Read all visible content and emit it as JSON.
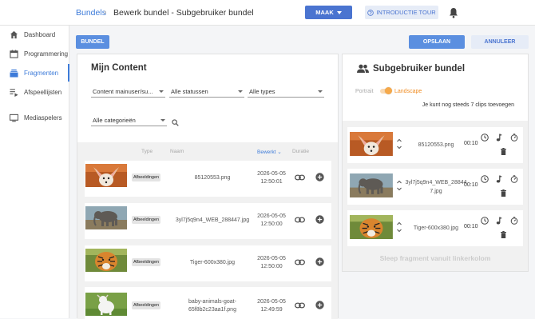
{
  "topbar": {
    "breadcrumb_root": "Bundels",
    "breadcrumb_sep": "›",
    "breadcrumb_current": "Bewerk bundel - Subgebruiker bundel",
    "maak_label": "MAAK",
    "tour_label": "INTRODUCTIE TOUR"
  },
  "sidebar": {
    "items": [
      {
        "label": "Dashboard",
        "icon": "home-icon"
      },
      {
        "label": "Programmering",
        "icon": "calendar-icon"
      },
      {
        "label": "Fragmenten",
        "icon": "fragments-icon",
        "active": true
      },
      {
        "label": "Afspeellijsten",
        "icon": "playlist-icon"
      },
      {
        "label": "Mediaspelers",
        "icon": "monitor-icon"
      }
    ]
  },
  "actions": {
    "bundel_label": "BUNDEL",
    "opslaan_label": "OPSLAAN",
    "annuleer_label": "ANNULEER"
  },
  "left_panel": {
    "title": "Mijn Content",
    "filters": {
      "content": "Content mainuser/su...",
      "status": "Alle statussen",
      "type": "Alle types",
      "category": "Alle categorieën"
    },
    "columns": {
      "type": "Type",
      "name": "Naam",
      "edited": "Bewerkt",
      "duration": "Duratie"
    },
    "rows": [
      {
        "badge": "Afbeeldingen",
        "name": "85120553.png",
        "date": "2026-05-05",
        "time": "12:50:01",
        "thumb": "fennec-fox"
      },
      {
        "badge": "Afbeeldingen",
        "name": "3yl7j5q9n4_WEB_288447.jpg",
        "date": "2026-05-05",
        "time": "12:50:00",
        "thumb": "elephant"
      },
      {
        "badge": "Afbeeldingen",
        "name": "Tiger-600x380.jpg",
        "date": "2026-05-05",
        "time": "12:50:00",
        "thumb": "tiger"
      },
      {
        "badge": "Afbeeldingen",
        "name": "baby-animals-goat-65f8b2c23aa1f.png",
        "date": "2026-05-05",
        "time": "12:49:59",
        "thumb": "goat"
      }
    ]
  },
  "right_panel": {
    "title": "Subgebruiker bundel",
    "toggle_portrait": "Portrait",
    "toggle_landscape": "Landscape",
    "clips_note": "Je kunt nog steeds 7 clips toevoegen",
    "clips": [
      {
        "name": "85120553.png",
        "duration": "00:10",
        "thumb": "fennec-fox"
      },
      {
        "name": "3yl7j5q9n4_WEB_288447.jpg",
        "duration": "00:10",
        "thumb": "elephant"
      },
      {
        "name": "Tiger-600x380.jpg",
        "duration": "00:10",
        "thumb": "tiger"
      }
    ],
    "drop_hint": "Sleep fragment vanuit linkerkolom"
  },
  "colors": {
    "accent": "#3d7bd9",
    "primary_button": "#5b8fe0",
    "toggle": "#f6a94a"
  }
}
